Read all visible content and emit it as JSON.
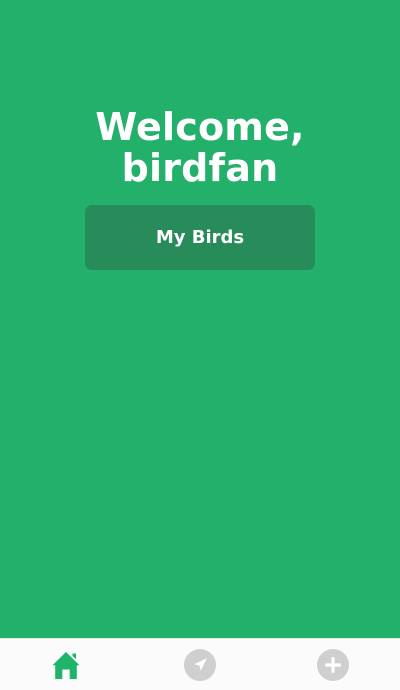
{
  "main": {
    "welcome_line_1": "Welcome,",
    "welcome_line_2": "birdfan",
    "my_birds_label": "My Birds"
  },
  "tabbar": {
    "items": [
      {
        "icon": "home-icon",
        "active": true
      },
      {
        "icon": "navigation-icon",
        "active": false
      },
      {
        "icon": "add-icon",
        "active": false
      }
    ]
  },
  "colors": {
    "background": "#22b06b",
    "button": "#278b5a",
    "text": "#ffffff",
    "tabbar": "#fbfbfb",
    "active_icon": "#20b36a",
    "inactive_icon": "#cfcfcf"
  }
}
